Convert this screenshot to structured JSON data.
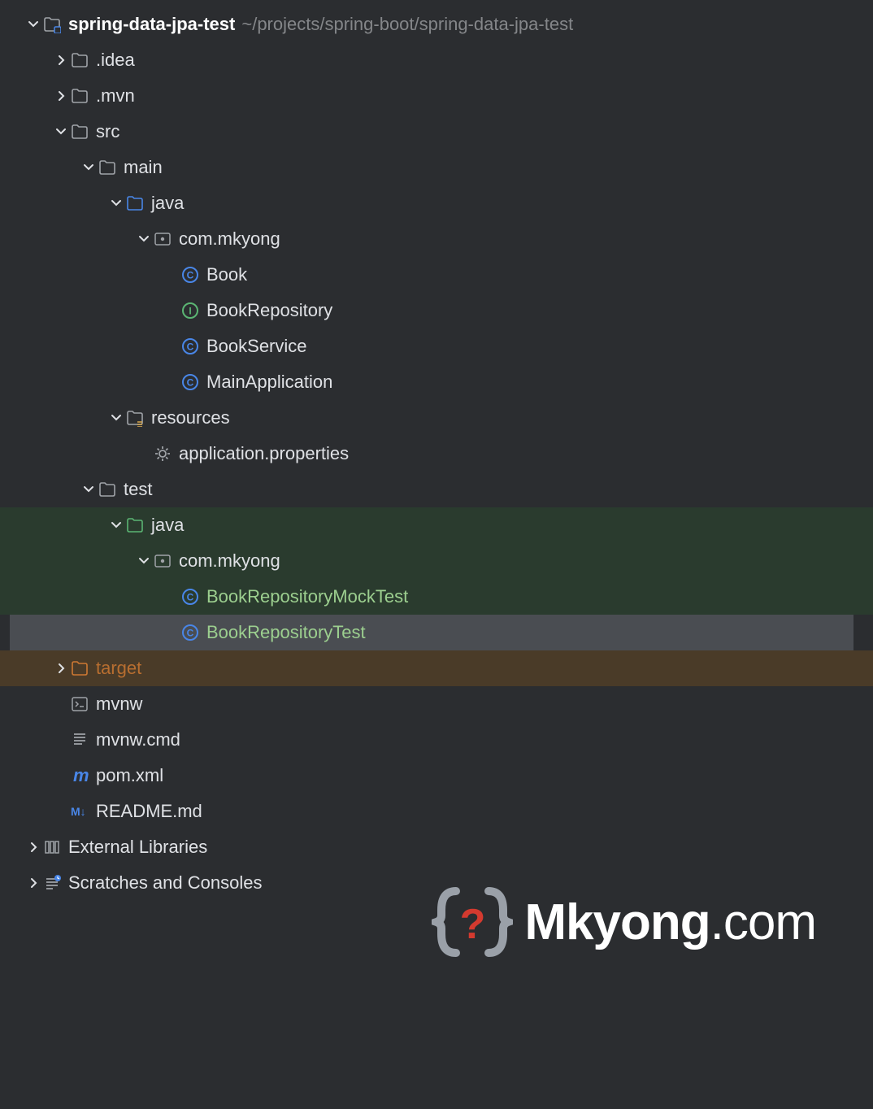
{
  "project": {
    "name": "spring-data-jpa-test",
    "path": "~/projects/spring-boot/spring-data-jpa-test"
  },
  "tree": {
    "idea": ".idea",
    "mvn": ".mvn",
    "src": "src",
    "main": "main",
    "java_main": "java",
    "pkg_main": "com.mkyong",
    "book": "Book",
    "book_repo": "BookRepository",
    "book_service": "BookService",
    "main_app": "MainApplication",
    "resources": "resources",
    "app_props": "application.properties",
    "test": "test",
    "java_test": "java",
    "pkg_test": "com.mkyong",
    "mock_test": "BookRepositoryMockTest",
    "repo_test": "BookRepositoryTest",
    "target": "target",
    "mvnw": "mvnw",
    "mvnw_cmd": "mvnw.cmd",
    "pom": "pom.xml",
    "readme": "README.md",
    "ext_libs": "External Libraries",
    "scratches": "Scratches and Consoles"
  },
  "watermark": {
    "name": "Mkyong",
    "suffix": ".com"
  }
}
